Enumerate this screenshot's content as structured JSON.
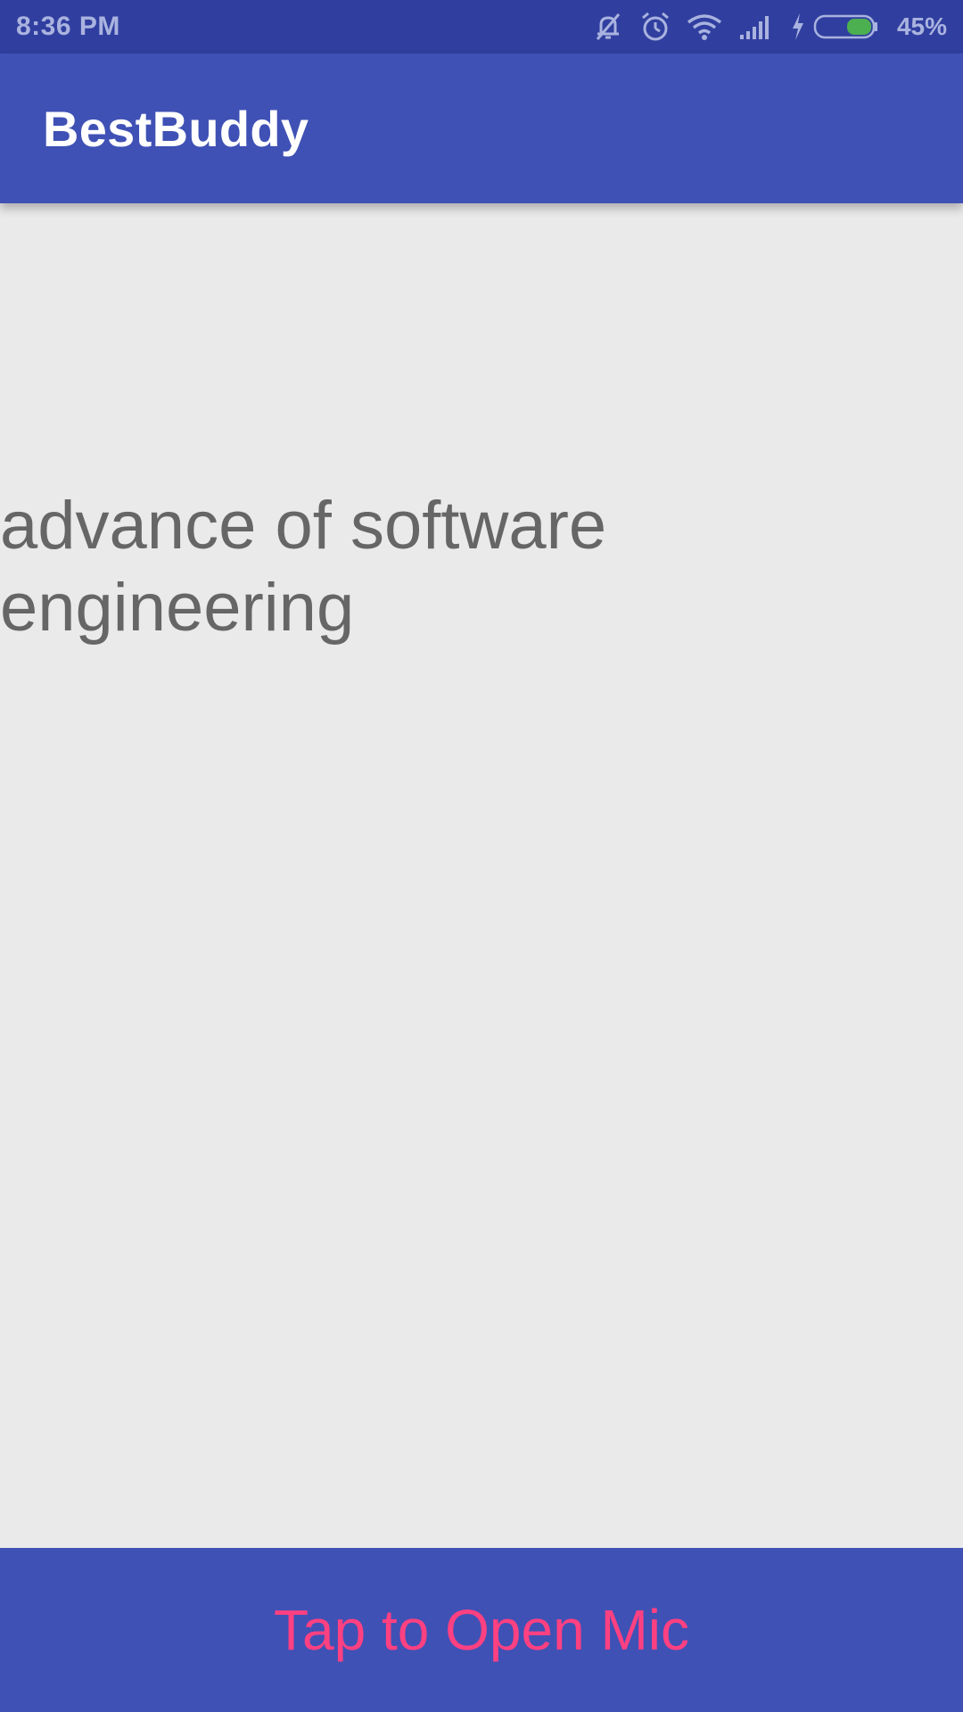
{
  "status_bar": {
    "time": "8:36 PM",
    "battery_percent": "45%",
    "battery_level": 0.45,
    "icons": [
      "silent-mode-icon",
      "alarm-icon",
      "wifi-icon",
      "signal-icon",
      "charging-icon",
      "battery-icon"
    ]
  },
  "app_bar": {
    "title": "BestBuddy"
  },
  "content": {
    "recognized_text": "advance of software engineering"
  },
  "bottom_button": {
    "label": "Tap to Open Mic"
  },
  "colors": {
    "status_bar": "#303f9f",
    "primary": "#3f51b5",
    "accent": "#ff4081",
    "background": "#eaeaea",
    "text": "#666666"
  }
}
